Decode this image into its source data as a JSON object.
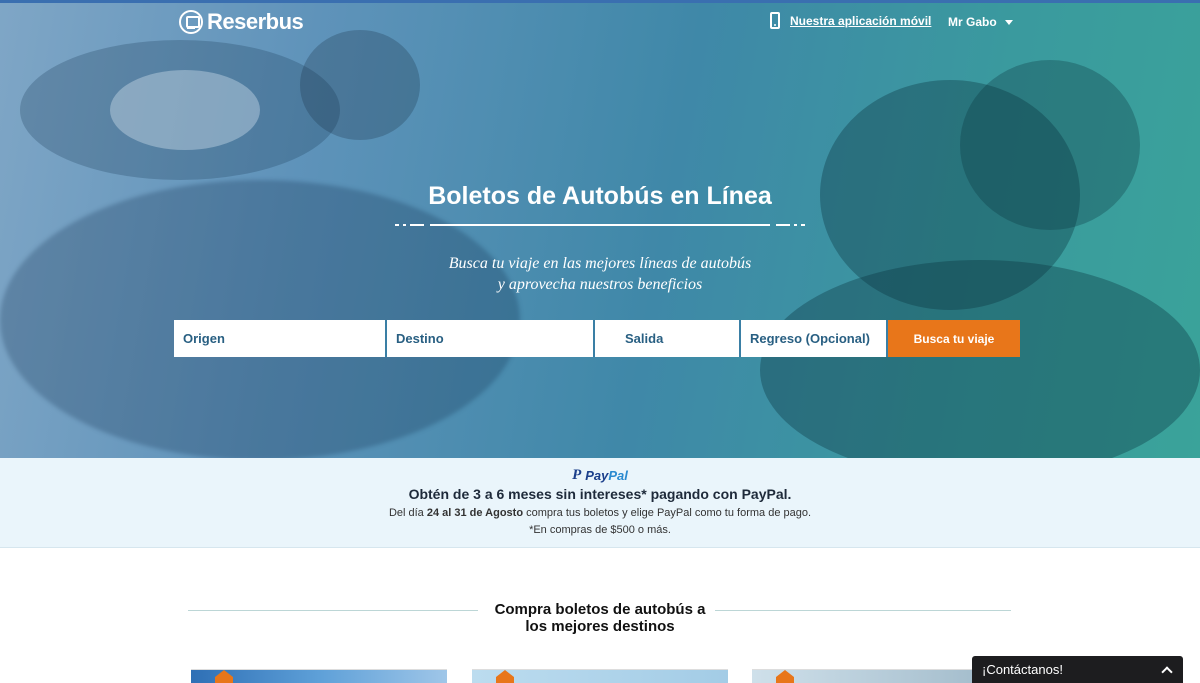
{
  "header": {
    "logo_text": "Reserbus",
    "app_link": "Nuestra aplicación móvil",
    "user_name": "Mr Gabo"
  },
  "hero": {
    "title": "Boletos de Autobús en Línea",
    "subtitle_line1": "Busca tu viaje en las mejores líneas de autobús",
    "subtitle_line2": "y aprovecha nuestros beneficios"
  },
  "search": {
    "origin_placeholder": "Origen",
    "destination_placeholder": "Destino",
    "departure_placeholder": "Salida",
    "return_placeholder": "Regreso (Opcional)",
    "button_label": "Busca tu viaje"
  },
  "promo": {
    "brand_part1": "Pay",
    "brand_part2": "Pal",
    "title": "Obtén de 3 a 6 meses sin intereses* pagando con PayPal.",
    "line_prefix": "Del día ",
    "line_bold": "24 al 31 de Agosto",
    "line_suffix": " compra tus boletos y elige PayPal como tu forma de pago.",
    "note": "*En compras de $500 o más."
  },
  "destinations": {
    "title_line1": "Compra boletos de autobús a",
    "title_line2": "los mejores destinos"
  },
  "contact": {
    "label": "¡Contáctanos!"
  },
  "colors": {
    "accent_orange": "#e8761a",
    "field_text_blue": "#285f82",
    "promo_bg": "#eaf5fb"
  }
}
